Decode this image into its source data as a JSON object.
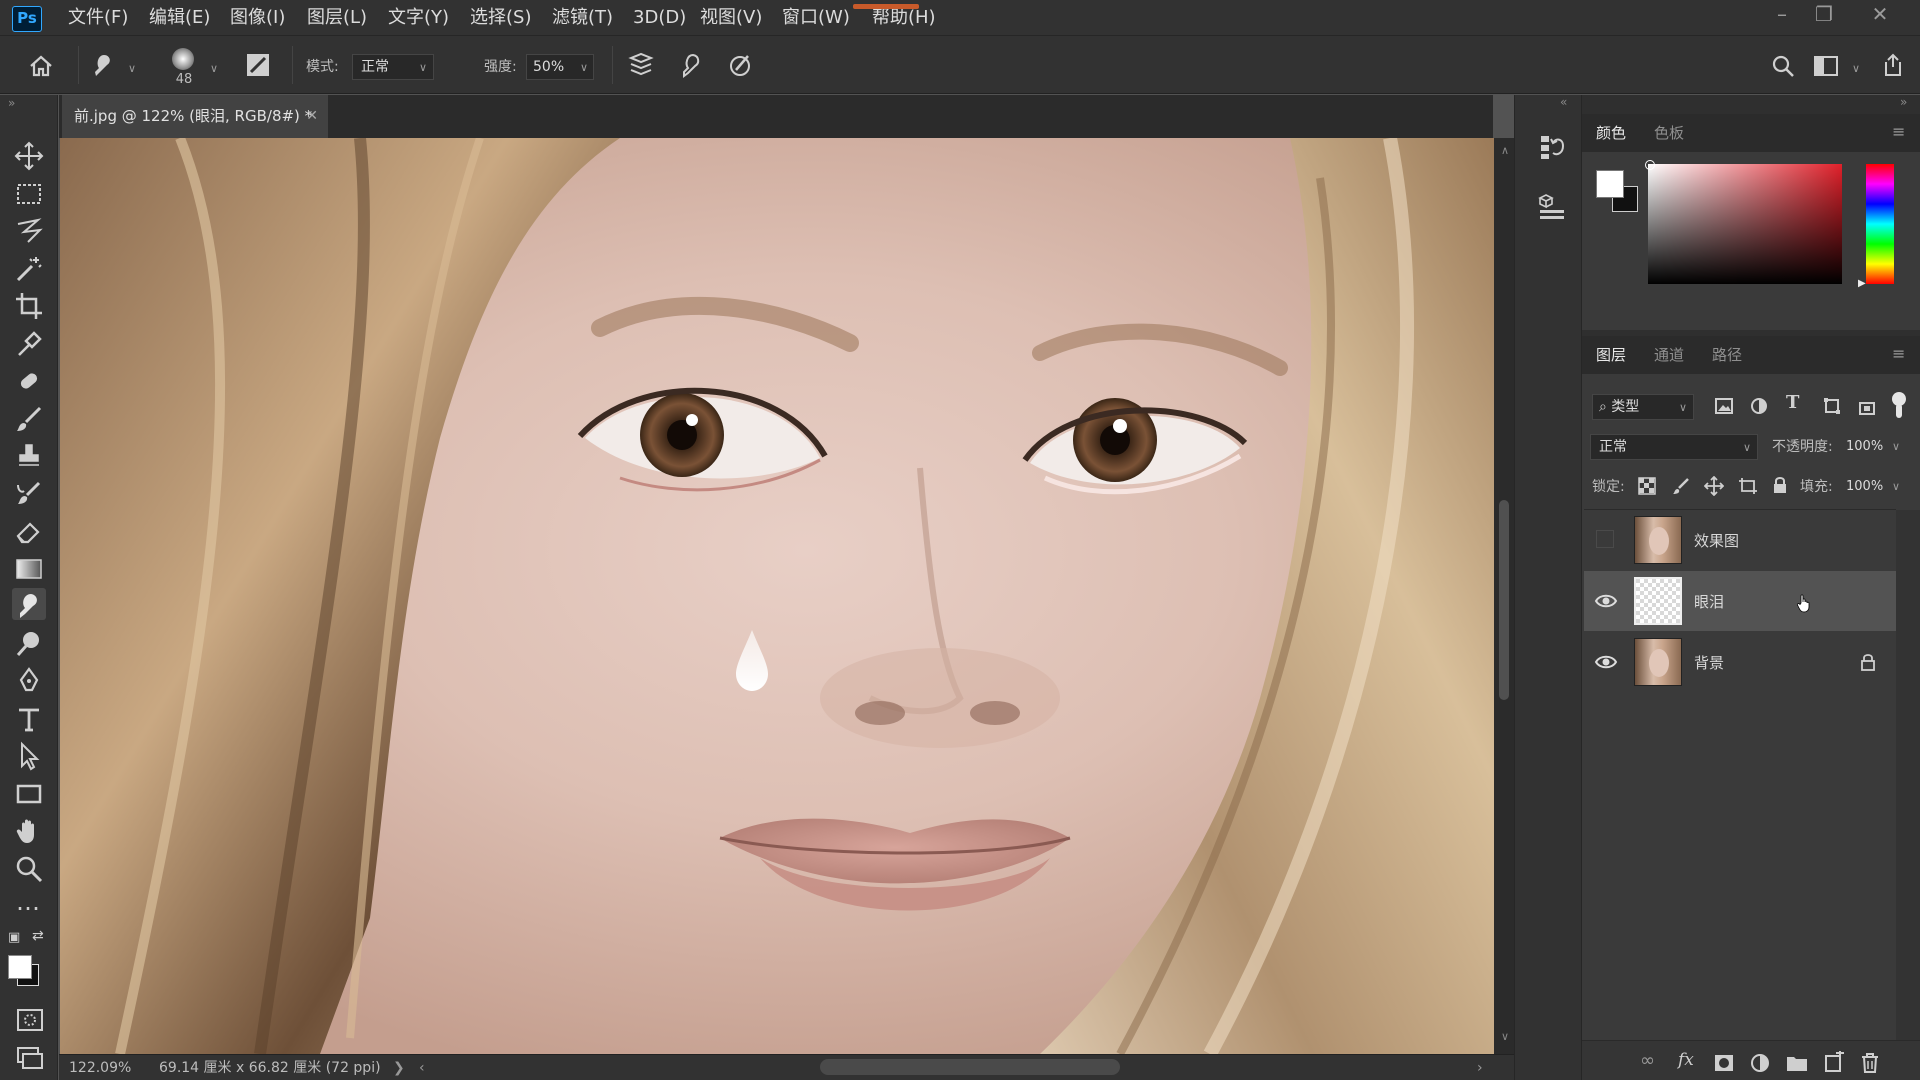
{
  "app": {
    "logo_text": "Ps"
  },
  "menu": [
    {
      "label": "文件(F)"
    },
    {
      "label": "编辑(E)"
    },
    {
      "label": "图像(I)"
    },
    {
      "label": "图层(L)"
    },
    {
      "label": "文字(Y)"
    },
    {
      "label": "选择(S)"
    },
    {
      "label": "滤镜(T)"
    },
    {
      "label": "3D(D)"
    },
    {
      "label": "视图(V)"
    },
    {
      "label": "窗口(W)"
    },
    {
      "label": "帮助(H)"
    }
  ],
  "options": {
    "brush_size": "48",
    "mode_label": "模式:",
    "mode_value": "正常",
    "strength_label": "强度:",
    "strength_value": "50%"
  },
  "document": {
    "tab_title": "前.jpg @ 122% (眼泪, RGB/8#) *"
  },
  "status": {
    "zoom": "122.09%",
    "doc_size": "69.14 厘米 x 66.82 厘米 (72 ppi)"
  },
  "color_panel": {
    "tabs": [
      "颜色",
      "色板"
    ],
    "active_tab": 0,
    "hue_color": "#e0202a"
  },
  "layers_panel": {
    "tabs": [
      "图层",
      "通道",
      "路径"
    ],
    "active_tab": 0,
    "filter_label": "类型",
    "blend_mode": "正常",
    "opacity_label": "不透明度:",
    "opacity_value": "100%",
    "lock_label": "锁定:",
    "fill_label": "填充:",
    "fill_value": "100%",
    "layers": [
      {
        "name": "效果图",
        "visible": false,
        "selected": false,
        "locked": false
      },
      {
        "name": "眼泪",
        "visible": true,
        "selected": true,
        "locked": false
      },
      {
        "name": "背景",
        "visible": true,
        "selected": false,
        "locked": true
      }
    ]
  }
}
